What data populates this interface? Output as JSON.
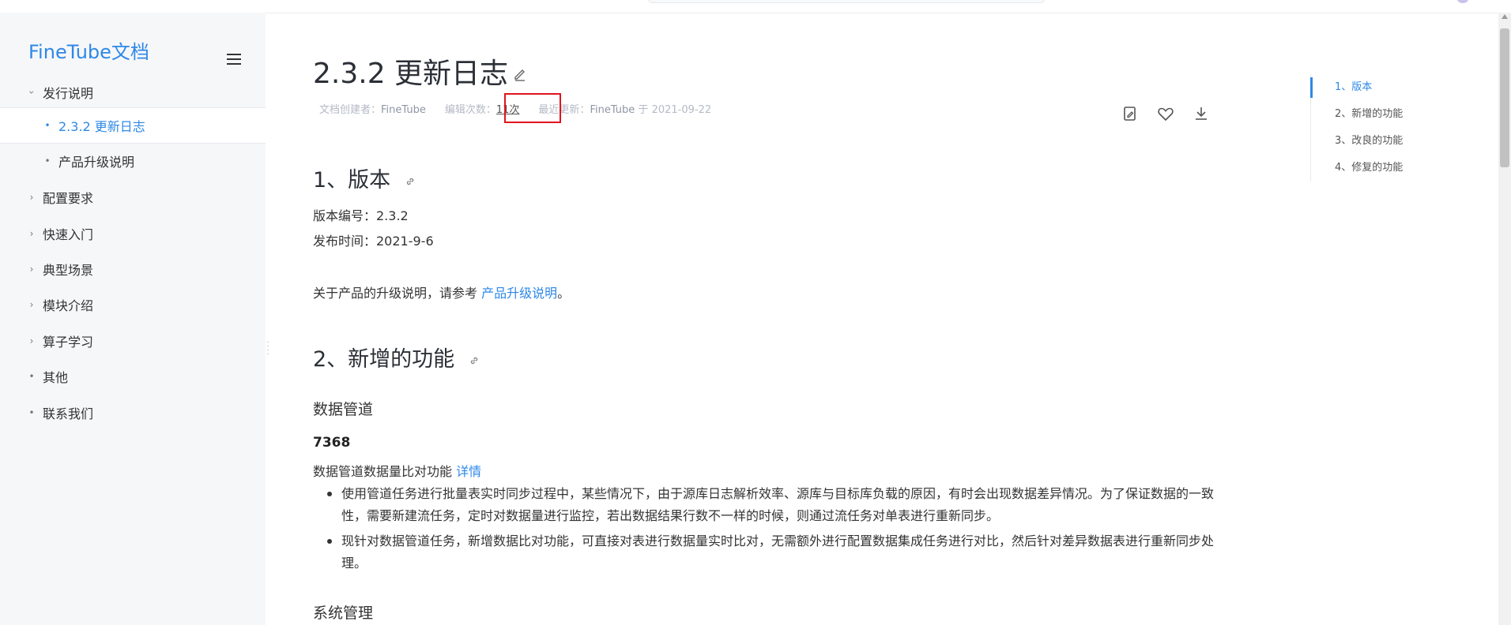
{
  "sidebar": {
    "brand": "FineTube文档",
    "items": [
      {
        "label": "发行说明",
        "marker": "›"
      },
      {
        "label": "2.3.2 更新日志",
        "marker": "•"
      },
      {
        "label": "产品升级说明",
        "marker": "•"
      },
      {
        "label": "配置要求",
        "marker": "›"
      },
      {
        "label": "快速入门",
        "marker": "›"
      },
      {
        "label": "典型场景",
        "marker": "›"
      },
      {
        "label": "模块介绍",
        "marker": "›"
      },
      {
        "label": "算子学习",
        "marker": "›"
      },
      {
        "label": "其他",
        "marker": "•"
      },
      {
        "label": "联系我们",
        "marker": "•"
      }
    ]
  },
  "doc": {
    "title": "2.3.2 更新日志",
    "meta": {
      "creator_label": "文档创建者：",
      "creator": "FineTube",
      "edit_label": "编辑次数：",
      "edit_count": "11次",
      "updated_label": "最近更新：",
      "updated_by": "FineTube",
      "updated_at_prefix": "于",
      "updated_at": "2021-09-22"
    },
    "sections": {
      "s1": {
        "title": "1、版本",
        "version_line": "版本编号：2.3.2",
        "release_line": "发布时间：2021-9-6",
        "upgrade_prefix": "关于产品的升级说明，请参考",
        "upgrade_link": "产品升级说明",
        "upgrade_suffix": "。"
      },
      "s2": {
        "title": "2、新增的功能",
        "sub1": "数据管道",
        "id": "7368",
        "feature_text": "数据管道数据量比对功能",
        "feature_link": "详情",
        "bullets": [
          "使用管道任务进行批量表实时同步过程中，某些情况下，由于源库日志解析效率、源库与目标库负载的原因，有时会出现数据差异情况。为了保证数据的一致性，需要新建流任务，定时对数据量进行监控，若出数据结果行数不一样的时候，则通过流任务对单表进行重新同步。",
          "现针对数据管道任务，新增数据比对功能，可直接对表进行数据量实时比对，无需额外进行配置数据集成任务进行对比，然后针对差异数据表进行重新同步处理。"
        ],
        "sub2": "系统管理"
      }
    }
  },
  "toc": {
    "items": [
      "1、版本",
      "2、新增的功能",
      "3、改良的功能",
      "4、修复的功能"
    ]
  },
  "colors": {
    "accent": "#2e88e8",
    "highlight": "#e0141e",
    "sidebar_bg": "#f6f7f9"
  },
  "icons": [
    "menu-icon",
    "pencil-icon",
    "link-icon",
    "copy-doc-icon",
    "heart-icon",
    "download-icon"
  ]
}
